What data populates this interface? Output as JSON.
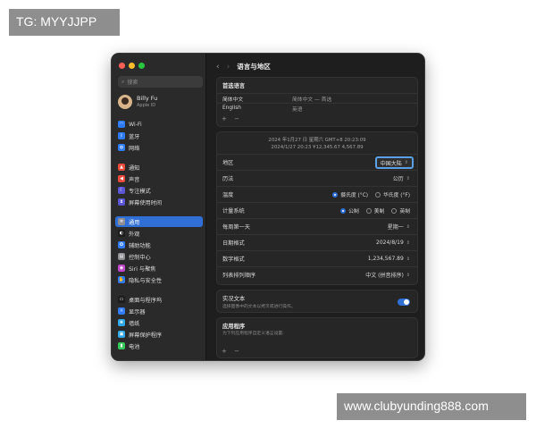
{
  "watermarks": {
    "top_left": "TG: MYYJJPP",
    "bottom_right": "www.clubyunding888.com"
  },
  "colors": {
    "accent": "#2f6fd6",
    "window_bg": "#1e1e1e",
    "sidebar_bg": "#2a2a2a",
    "highlight_border": "#5aa0e6"
  },
  "sidebar": {
    "search_placeholder": "搜索",
    "account": {
      "name": "Billy Fu",
      "sub": "Apple ID"
    },
    "items": [
      {
        "label": "Wi-Fi",
        "icon": "wifi-icon",
        "color": "#2f7bf6"
      },
      {
        "label": "蓝牙",
        "icon": "bluetooth-icon",
        "color": "#2f7bf6"
      },
      {
        "label": "网络",
        "icon": "globe-icon",
        "color": "#2f7bf6"
      },
      {
        "label": "通知",
        "icon": "bell-icon",
        "color": "#e84a3c"
      },
      {
        "label": "声音",
        "icon": "speaker-icon",
        "color": "#e84a3c"
      },
      {
        "label": "专注模式",
        "icon": "moon-icon",
        "color": "#5a55d6"
      },
      {
        "label": "屏幕使用时间",
        "icon": "hourglass-icon",
        "color": "#5a55d6"
      },
      {
        "label": "通用",
        "icon": "gear-icon",
        "color": "#8e8e93"
      },
      {
        "label": "外观",
        "icon": "appearance-icon",
        "color": "#1c1c1c"
      },
      {
        "label": "辅助功能",
        "icon": "accessibility-icon",
        "color": "#2f7bf6"
      },
      {
        "label": "控制中心",
        "icon": "control-center-icon",
        "color": "#8e8e93"
      },
      {
        "label": "Siri 与聚焦",
        "icon": "siri-icon",
        "color": "#c146c9"
      },
      {
        "label": "隐私与安全性",
        "icon": "hand-icon",
        "color": "#2f7bf6"
      },
      {
        "label": "桌面与程序坞",
        "icon": "dock-icon",
        "color": "#1c1c1c"
      },
      {
        "label": "显示器",
        "icon": "display-icon",
        "color": "#2f7bf6"
      },
      {
        "label": "墙纸",
        "icon": "wallpaper-icon",
        "color": "#2fa8e6"
      },
      {
        "label": "屏幕保护程序",
        "icon": "screensaver-icon",
        "color": "#2fa8e6"
      },
      {
        "label": "电池",
        "icon": "battery-icon",
        "color": "#34c759"
      }
    ]
  },
  "header": {
    "back": "‹",
    "forward": "›",
    "title": "语言与地区"
  },
  "preferred_languages": {
    "title": "首选语言",
    "rows": [
      {
        "name": "简体中文",
        "detail": "简体中文 — 首选"
      },
      {
        "name": "English",
        "detail": "英语"
      }
    ],
    "add": "+",
    "remove": "−"
  },
  "preview": {
    "line1": "2024 年1月27 日 星期六 GMT+8 20:23:09",
    "line2": "2024/1/27 20:23    ¥12,345.67    4,567.89"
  },
  "settings": {
    "region": {
      "label": "地区",
      "value": "中国大陆"
    },
    "calendar": {
      "label": "历法",
      "value": "公历"
    },
    "temperature": {
      "label": "温度",
      "opt1": "摄氏度 (°C)",
      "opt2": "华氏度 (°F)"
    },
    "measurement": {
      "label": "计量系统",
      "opt1": "公制",
      "opt2": "美制",
      "opt3": "英制"
    },
    "first_day": {
      "label": "每周第一天",
      "value": "星期一"
    },
    "date_format": {
      "label": "日期格式",
      "value": "2024/8/19"
    },
    "number_format": {
      "label": "数字格式",
      "value": "1,234,567.89"
    },
    "list_sort": {
      "label": "列表排列顺序",
      "value": "中文 (拼音排序)"
    }
  },
  "live_text": {
    "title": "实况文本",
    "desc": "选择图像中的文本以拷贝或进行操作。"
  },
  "apps": {
    "title": "应用程序",
    "desc": "为下列应用程序自定义语言设置:",
    "add": "+",
    "remove": "−"
  }
}
